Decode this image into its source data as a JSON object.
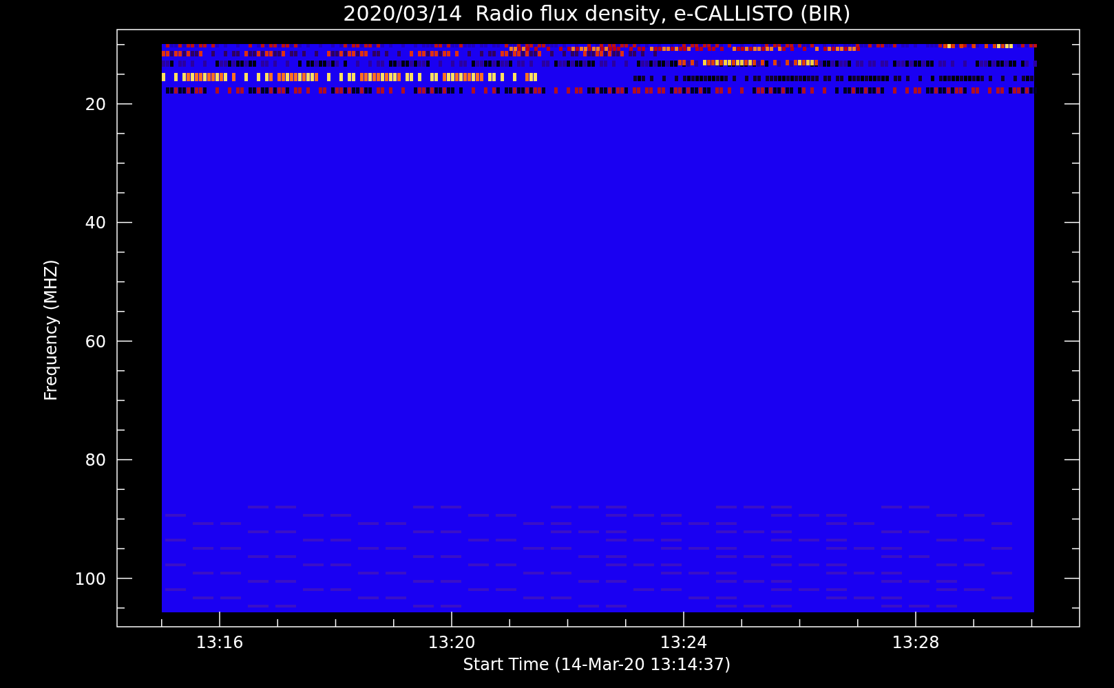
{
  "title": "2020/03/14  Radio flux density, e-CALLISTO (BIR)",
  "y_axis": {
    "label": "Frequency (MHZ)",
    "ticks": [
      "20",
      "40",
      "60",
      "80",
      "100"
    ]
  },
  "x_axis": {
    "label": "Start Time (14-Mar-20 13:14:37)",
    "ticks": [
      "13:16",
      "13:20",
      "13:24",
      "13:28"
    ]
  }
}
